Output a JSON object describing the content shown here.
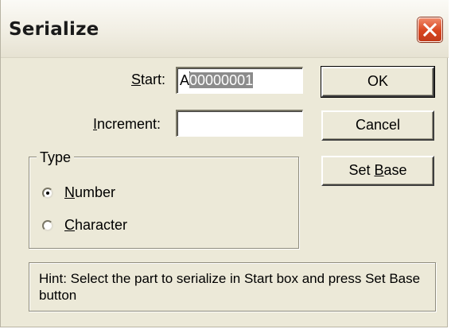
{
  "window": {
    "title": "Serialize",
    "close_icon": "close-icon"
  },
  "fields": {
    "start": {
      "label_pre": "",
      "label_mnemonic": "S",
      "label_post": "tart:",
      "value_unselected": "A",
      "value_selected": "00000001"
    },
    "increment": {
      "label_pre": "",
      "label_mnemonic": "I",
      "label_post": "ncrement:",
      "value": ""
    }
  },
  "type_group": {
    "legend": "Type",
    "options": [
      {
        "mnemonic": "N",
        "rest": "umber",
        "selected": true
      },
      {
        "mnemonic": "C",
        "rest": "haracter",
        "selected": false
      }
    ]
  },
  "buttons": {
    "ok": "OK",
    "cancel": "Cancel",
    "set_base_pre": "Set ",
    "set_base_mnemonic": "B",
    "set_base_post": "ase"
  },
  "hint": "Hint: Select the part to serialize in Start box and press Set Base button",
  "colors": {
    "dialog_bg": "#ece9d8",
    "selection_bg": "#8b8b8b",
    "close_button": "#d8451f"
  }
}
